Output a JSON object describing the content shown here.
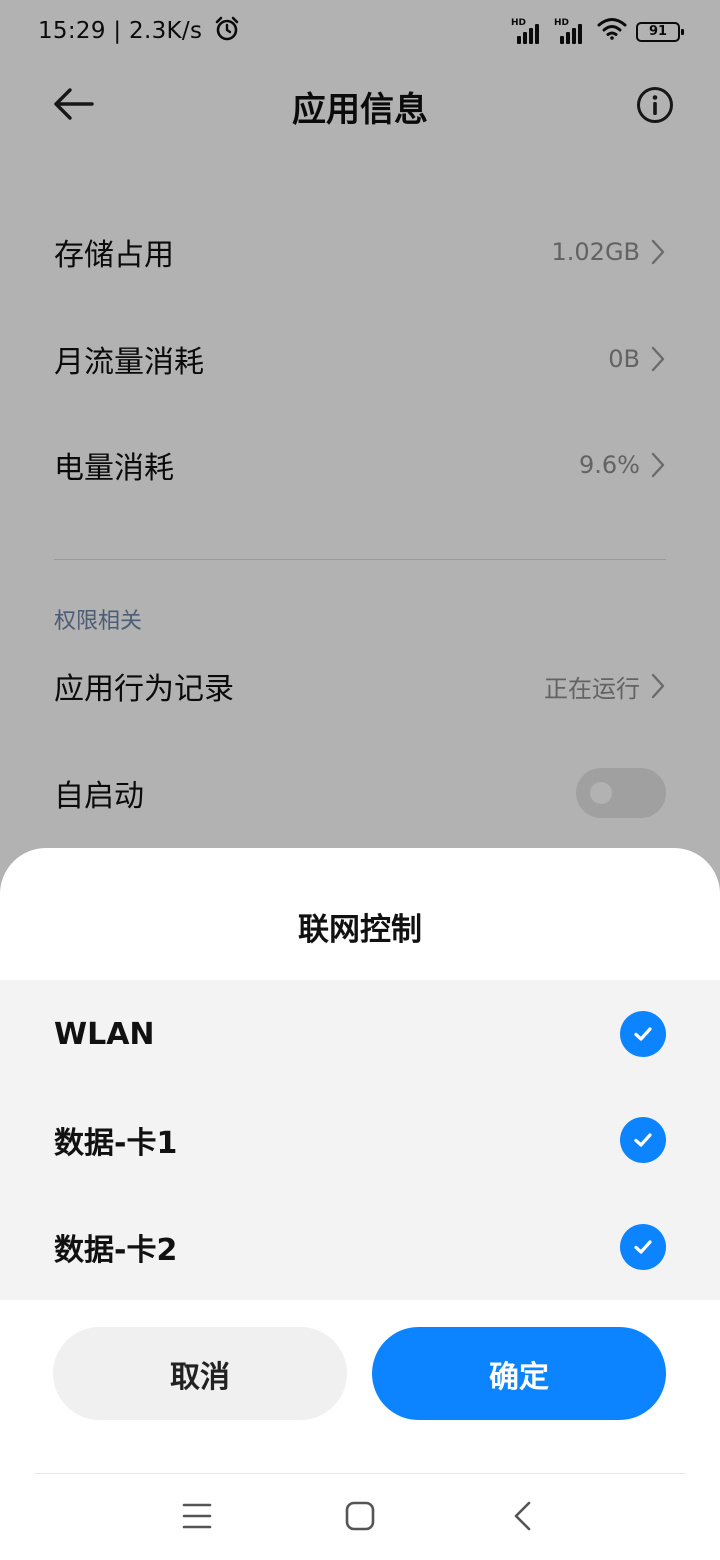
{
  "status_bar": {
    "time": "15:29 | 2.3K/s",
    "sim1_tag": "HD",
    "sim2_tag": "HD",
    "battery": "91",
    "icons": [
      "alarm-icon",
      "signal-icon",
      "signal-icon",
      "wifi-icon",
      "battery-icon"
    ]
  },
  "header": {
    "title": "应用信息",
    "back_icon": "arrow-left-icon",
    "info_icon": "info-icon"
  },
  "usage_rows": [
    {
      "label": "存储占用",
      "value": "1.02GB"
    },
    {
      "label": "月流量消耗",
      "value": "0B"
    },
    {
      "label": "电量消耗",
      "value": "9.6%"
    }
  ],
  "permissions": {
    "section_title": "权限相关",
    "behavior_label": "应用行为记录",
    "behavior_value": "正在运行",
    "autostart_label": "自启动",
    "autostart_on": false
  },
  "sheet": {
    "title": "联网控制",
    "options": [
      {
        "label": "WLAN",
        "checked": true
      },
      {
        "label": "数据-卡1",
        "checked": true
      },
      {
        "label": "数据-卡2",
        "checked": true
      }
    ],
    "cancel_label": "取消",
    "confirm_label": "确定"
  },
  "nav_bar": {
    "icons": [
      "menu-icon",
      "home-icon",
      "back-icon"
    ]
  },
  "colors": {
    "accent": "#0d84ff",
    "section_title": "#6f86a8",
    "value_gray": "#8e8e8e"
  }
}
